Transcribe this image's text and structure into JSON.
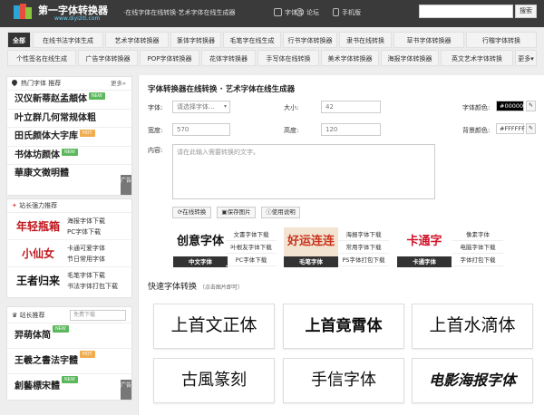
{
  "header": {
    "site_name": "第一字体转换器",
    "site_domain": "www.diyiziti.com",
    "slogan": "·在线字体在线转换·艺术字体在线生成器",
    "links": [
      "字体库",
      "论坛",
      "手机版"
    ],
    "search_placeholder": "",
    "search_button": "搜索"
  },
  "nav": {
    "row1": [
      "全部",
      "在线书法字体生成",
      "艺术字体转换器",
      "篆体字转换器",
      "毛笔字在线生成",
      "行书字体转换器",
      "隶书在线转换",
      "草书字体转换器",
      "行楷字体转换"
    ],
    "row2": [
      "个性签名在线生成",
      "广告字体转换器",
      "POP字体转换器",
      "花体字转换器",
      "手写体在线转换",
      "美术字体转换器",
      "海报字体转换器",
      "英文艺术字体转换",
      "更多▾"
    ]
  },
  "hot_fonts": {
    "title": "热门字体",
    "subtitle": "推荐",
    "more": "更多»",
    "items": [
      {
        "name": "汉仪新蒂赵孟頫体",
        "badge": "NEW"
      },
      {
        "name": "叶立群几何常规体粗",
        "badge": ""
      },
      {
        "name": "田氏颜体大字库",
        "badge": "HOT"
      },
      {
        "name": "书体坊颜体",
        "badge": "NEW"
      },
      {
        "name": "華康文徵明體",
        "badge": ""
      }
    ],
    "ad": "广告"
  },
  "recommend": {
    "title": "站长强力推荐",
    "rows": [
      {
        "image_text": "年轻瓶箱",
        "links": [
          "海报字体下载",
          "PC字体下载"
        ]
      },
      {
        "image_text": "小仙女",
        "links": [
          "卡通可爱字体",
          "节日常用字体"
        ]
      },
      {
        "image_text": "王者归来",
        "links": [
          "毛笔字体下载",
          "书法字体打包下载"
        ]
      }
    ]
  },
  "webmaster": {
    "title": "站长推荐",
    "search_placeholder": "免费下载",
    "items": [
      {
        "name": "羿萌体简",
        "badge": "NEW"
      },
      {
        "name": "王羲之書法字體",
        "badge": "HOT"
      },
      {
        "name": "創藝標宋體",
        "badge": "NEW"
      }
    ],
    "ad": "广告"
  },
  "main": {
    "title": "字体转换器在线转换 · 艺术字体在线生成器",
    "font_label": "字体:",
    "font_select": "请选择字体...",
    "size_label": "大小:",
    "size_value": "42",
    "font_color_label": "字体颜色:",
    "font_color": "#000000",
    "width_label": "宽度:",
    "width_value": "570",
    "height_label": "高度:",
    "height_value": "120",
    "bg_color_label": "背景颜色:",
    "bg_color": "#FFFFFF",
    "content_label": "内容:",
    "content_placeholder": "请在此输入需要转换的文字。",
    "buttons": [
      "在线转换",
      "保存图片",
      "使用说明"
    ]
  },
  "categories": [
    {
      "image_text": "创意字体",
      "label": "中文字体",
      "color": "#111111",
      "links": [
        "文書字体下载",
        "叶根友字体下载",
        "PC字体下载"
      ]
    },
    {
      "image_text": "好运连连",
      "label": "毛笔字体",
      "color": "#c8321b",
      "links": [
        "海报字体下载",
        "常用字体下载",
        "PS字体打包下载"
      ]
    },
    {
      "image_text": "卡通字",
      "label": "卡通字体",
      "color": "#d0142a",
      "links": [
        "像素字体",
        "电脑字体下载",
        "字体打包下载"
      ]
    }
  ],
  "quick": {
    "title": "快速字体转换",
    "hint": "（点击图片即可）",
    "cards": [
      "上首文正体",
      "上首竟霄体",
      "上首水滴体",
      "古風篆刻",
      "手信字体",
      "电影海报字体"
    ]
  }
}
